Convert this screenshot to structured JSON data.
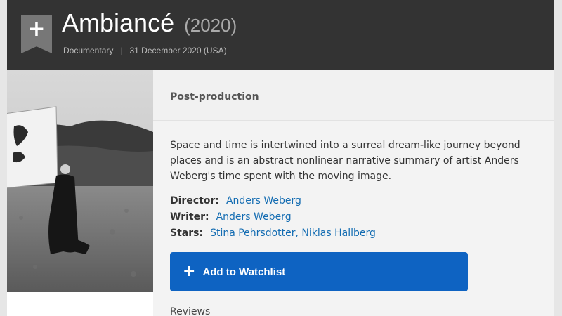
{
  "header": {
    "add_icon_glyph": "+",
    "title": "Ambiancé",
    "year": "(2020)",
    "genre": "Documentary",
    "separator": "|",
    "release": "31 December 2020 (USA)"
  },
  "poster": {
    "alt": "Black and white film still"
  },
  "status": "Post-production",
  "plot": "Space and time is intertwined into a surreal dream-like journey beyond places and is an abstract nonlinear narrative summary of artist Anders Weberg's time spent with the moving image.",
  "credits": {
    "director_label": "Director:",
    "director": "Anders Weberg",
    "writer_label": "Writer:",
    "writer": "Anders Weberg",
    "stars_label": "Stars:",
    "stars": [
      "Stina Pehrsdotter",
      "Niklas Hallberg"
    ],
    "stars_separator": ","
  },
  "watchlist": {
    "plus_glyph": "+",
    "label": "Add to Watchlist"
  },
  "reviews_label": "Reviews",
  "colors": {
    "header_bg": "#333333",
    "link": "#136cb2",
    "button": "#0e63c2"
  }
}
